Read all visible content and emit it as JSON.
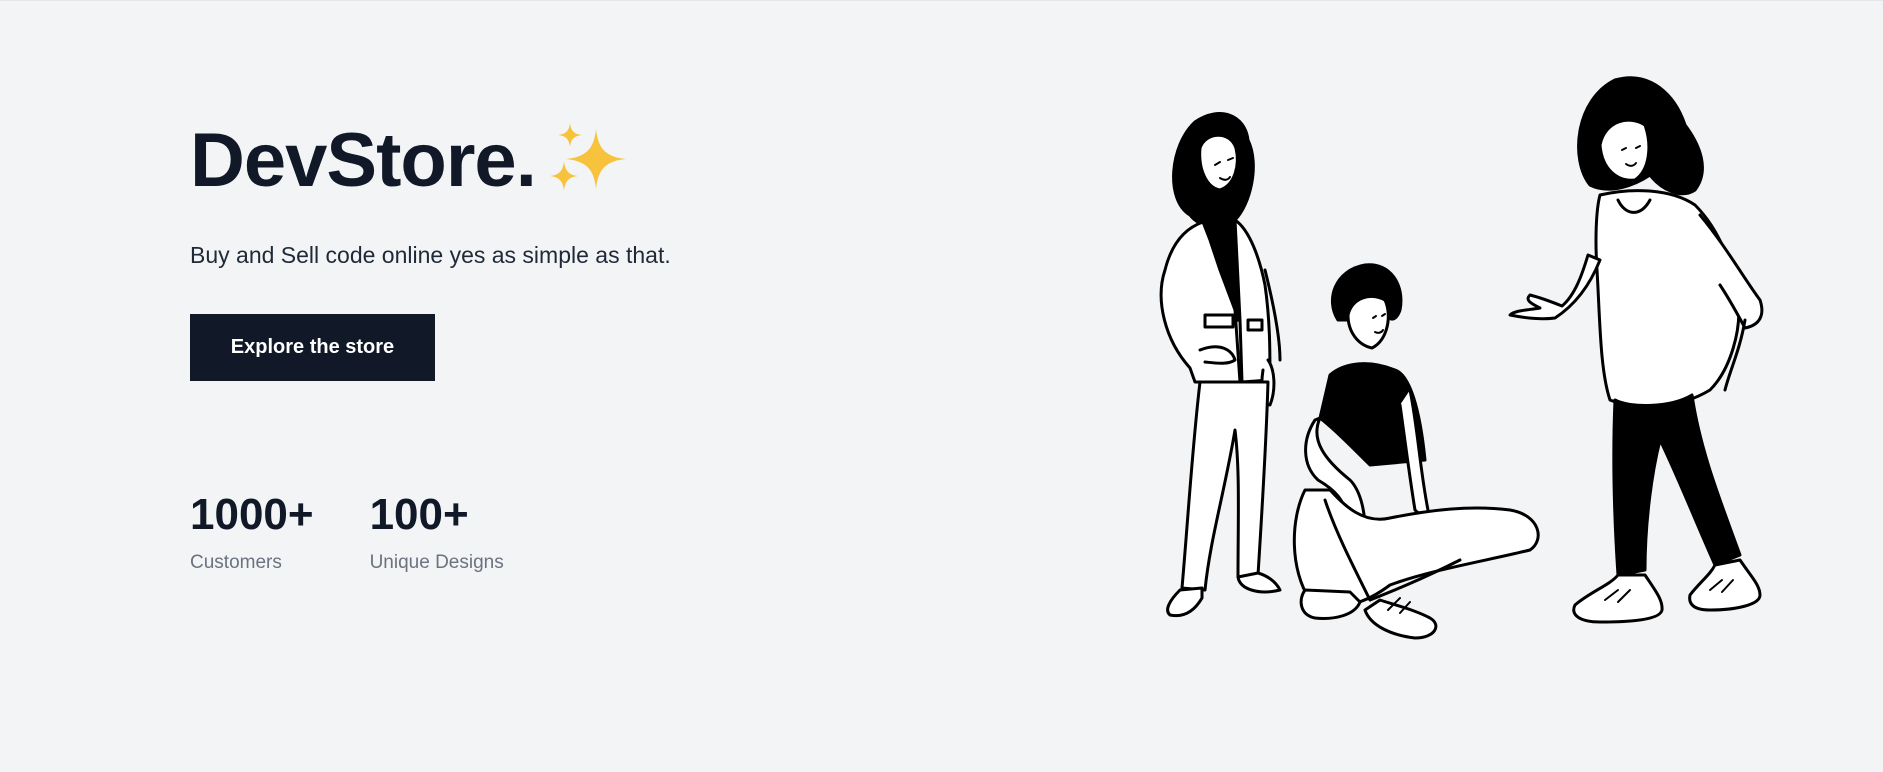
{
  "hero": {
    "title": "DevStore.",
    "subtitle": "Buy and Sell code online yes as simple as that.",
    "cta_label": "Explore the store",
    "sparkle_icon": "sparkles-icon",
    "accent_color": "#f7c23c"
  },
  "stats": [
    {
      "value": "1000+",
      "label": "Customers"
    },
    {
      "value": "100+",
      "label": "Unique Designs"
    }
  ],
  "colors": {
    "background": "#f3f4f6",
    "text": "#111827",
    "button": "#111827",
    "muted": "#6b7280"
  },
  "illustration": {
    "icon": "people-illustration"
  }
}
